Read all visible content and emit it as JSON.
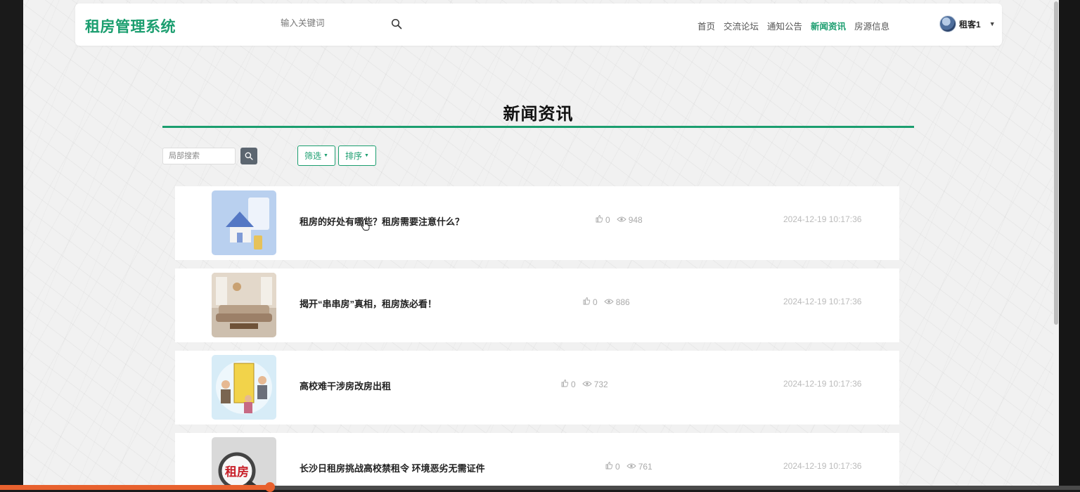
{
  "header": {
    "brand": "租房管理系统",
    "search_placeholder": "输入关键词",
    "nav": [
      {
        "label": "首页",
        "active": false
      },
      {
        "label": "交流论坛",
        "active": false
      },
      {
        "label": "通知公告",
        "active": false
      },
      {
        "label": "新闻资讯",
        "active": true
      },
      {
        "label": "房源信息",
        "active": false
      }
    ],
    "user_name": "租客1"
  },
  "page": {
    "title": "新闻资讯",
    "local_search_placeholder": "局部搜索",
    "filter_label": "筛选",
    "sort_label": "排序"
  },
  "news": [
    {
      "title": "租房的好处有哪些？租房需要注意什么？",
      "likes": "0",
      "views": "948",
      "date": "2024-12-19 10:17:36",
      "thumb": "house-model-keys-image"
    },
    {
      "title": "揭开“串串房”真相，租房族必看！",
      "likes": "0",
      "views": "886",
      "date": "2024-12-19 10:17:36",
      "thumb": "living-room-image"
    },
    {
      "title": "高校难干涉房改房出租",
      "likes": "0",
      "views": "732",
      "date": "2024-12-19 10:17:36",
      "thumb": "cartoon-people-building-image"
    },
    {
      "title": "长沙日租房挑战高校禁租令 环境恶劣无需证件",
      "likes": "0",
      "views": "761",
      "date": "2024-12-19 10:17:36",
      "thumb": "magnifier-rent-image",
      "thumb_text": "租房"
    }
  ],
  "colors": {
    "accent": "#1b9e6f",
    "text_dark": "#222222",
    "muted": "#aaaaaa"
  }
}
